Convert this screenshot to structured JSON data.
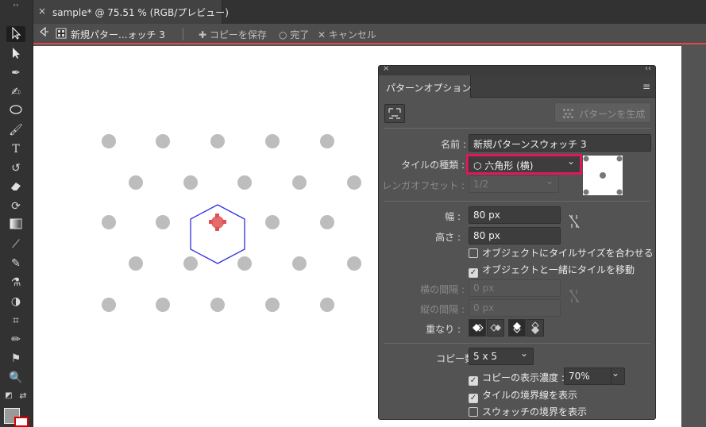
{
  "document": {
    "tab_close": "×",
    "tab_title": "sample* @ 75.51 % (RGB/プレビュー)"
  },
  "pattern_bar": {
    "swatch_name": "新規パター...ォッチ 3",
    "save_copy": "コピーを保存",
    "done": "完了",
    "cancel": "キャンセル"
  },
  "panel": {
    "close": "×",
    "collapse": "‹‹",
    "tab_title": "パターンオプション",
    "menu_icon": "≡",
    "generate_button": "パターンを生成",
    "name_label": "名前 :",
    "name_value": "新規パターンスウォッチ 3",
    "tile_type_label": "タイルの種類 :",
    "tile_type_value": "六角形 (横)",
    "brick_offset_label": "レンガオフセット :",
    "brick_offset_value": "1/2",
    "width_label": "幅 :",
    "width_value": "80 px",
    "height_label": "高さ :",
    "height_value": "80 px",
    "size_tile_to_art": "オブジェクトにタイルサイズを合わせる",
    "size_tile_to_art_checked": false,
    "move_tile_with_art": "オブジェクトと一緒にタイルを移動",
    "move_tile_with_art_checked": true,
    "h_spacing_label": "横の間隔 :",
    "h_spacing_value": "0 px",
    "v_spacing_label": "縦の間隔 :",
    "v_spacing_value": "0 px",
    "overlap_label": "重なり :",
    "copies_label": "コピー数 :",
    "copies_value": "5 x 5",
    "dim_copies_label": "コピーの表示濃度 :",
    "dim_copies_checked": true,
    "dim_copies_value": "70%",
    "show_tile_edge": "タイルの境界線を表示",
    "show_tile_edge_checked": true,
    "show_swatch_bounds": "スウォッチの境界を表示",
    "show_swatch_bounds_checked": false
  },
  "colors": {
    "highlight": "#e0175a",
    "hexagon": "#2e2ee0",
    "dot": "#bdbdbd",
    "selection": "#e04848"
  }
}
